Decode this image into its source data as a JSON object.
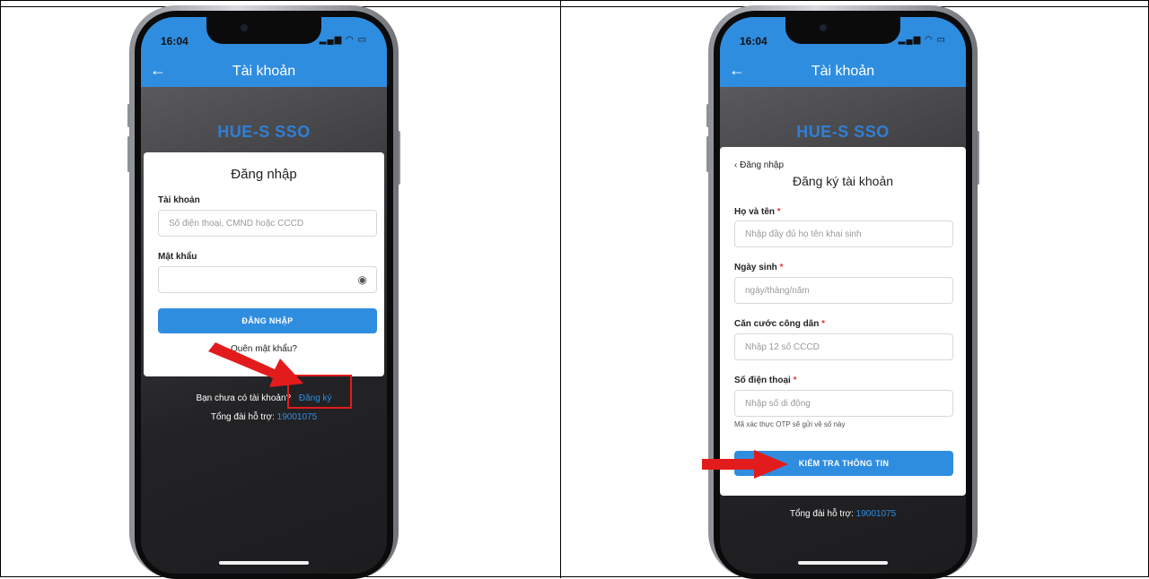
{
  "left_phone": {
    "time": "16:04",
    "status_icons": "▂▄▆ ◠ ▭",
    "app_title": "Tài khoản",
    "brand": "HUE-S SSO",
    "card_title": "Đăng nhập",
    "account_label": "Tài khoản",
    "account_placeholder": "Số điện thoại, CMND hoặc CCCD",
    "password_label": "Mật khẩu",
    "login_button": "ĐĂNG NHẬP",
    "forgot_password": "Quên mật khẩu?",
    "no_account_text": "Bạn chưa có tài khoản?",
    "register_link": "Đăng ký",
    "hotline_label": "Tổng đài hỗ trợ:",
    "hotline_number": "19001075"
  },
  "right_phone": {
    "time": "16:04",
    "status_icons": "▂▄▆ ◠ ▭",
    "app_title": "Tài khoản",
    "brand": "HUE-S SSO",
    "back_link": "Đăng nhập",
    "card_title": "Đăng ký tài khoản",
    "fullname_label": "Họ và tên",
    "fullname_placeholder": "Nhập đầy đủ họ tên khai sinh",
    "dob_label": "Ngày sinh",
    "dob_placeholder": "ngày/tháng/năm",
    "id_label": "Căn cước công dân",
    "id_placeholder": "Nhập 12 số CCCD",
    "phone_label": "Số điện thoại",
    "phone_placeholder": "Nhập số di động",
    "otp_note": "Mã xác thực OTP sẽ gửi về số này",
    "check_button": "KIỂM TRA THÔNG TIN",
    "hotline_label": "Tổng đài hỗ trợ:",
    "hotline_number": "19001075"
  },
  "required_mark": "*",
  "colors": {
    "accent": "#2f8de0",
    "annotation": "#e21c1c"
  },
  "icons": {
    "back": "arrow-left-icon",
    "eye": "eye-icon",
    "chevron": "chevron-left-icon"
  }
}
